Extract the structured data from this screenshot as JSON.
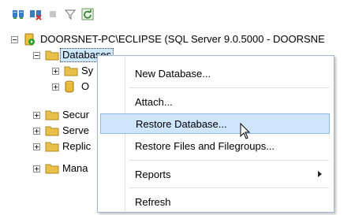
{
  "toolbar": {
    "buttons": [
      {
        "name": "connect-icon"
      },
      {
        "name": "disconnect-icon"
      },
      {
        "name": "stop-icon"
      },
      {
        "name": "filter-icon"
      },
      {
        "name": "refresh-icon"
      }
    ]
  },
  "tree": {
    "server_label": "DOORSNET-PC\\ECLIPSE (SQL Server 9.0.5000 - DOORSNE",
    "databases_label": "Databases",
    "system_db_label": "Sy",
    "other_db_label": "O",
    "security_label": "Secur",
    "server_objects_label": "Serve",
    "replication_label": "Replic",
    "management_label": "Mana"
  },
  "context_menu": {
    "items": [
      {
        "label": "New Database..."
      },
      {
        "label": "Attach..."
      },
      {
        "label": "Restore Database..."
      },
      {
        "label": "Restore Files and Filegroups..."
      },
      {
        "label": "Reports"
      },
      {
        "label": "Refresh"
      }
    ],
    "highlighted_item": "Restore Database..."
  },
  "colors": {
    "selection": "#cde8ff",
    "menu_hover": "#cfe5fc",
    "folder": "#e8c04a"
  }
}
